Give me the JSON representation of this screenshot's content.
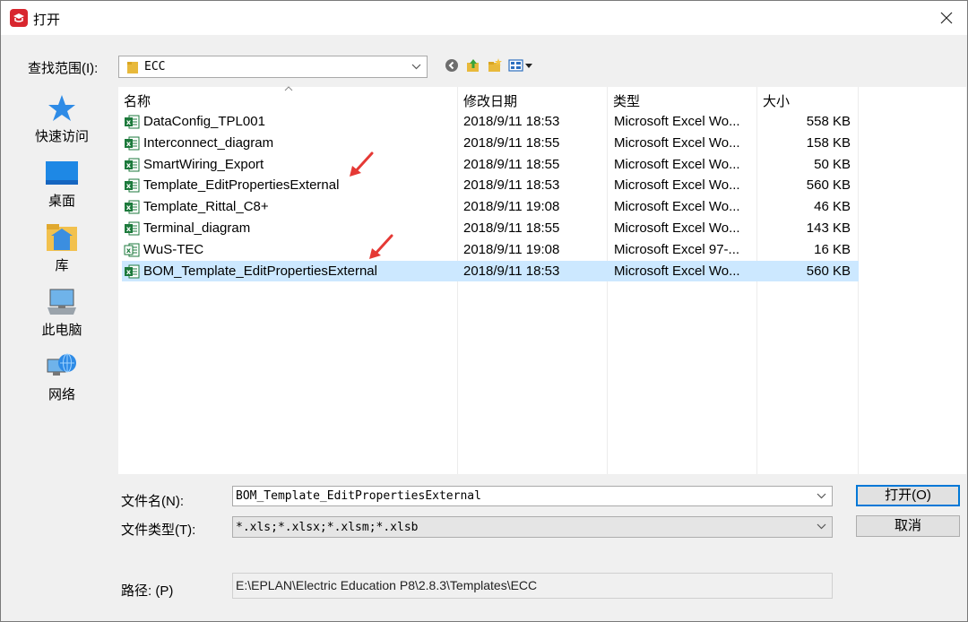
{
  "window": {
    "title": "打开"
  },
  "lookin": {
    "label": "查找范围(I):",
    "value": "ECC"
  },
  "toolbar": {
    "icons": [
      "back-icon",
      "up-folder-icon",
      "new-folder-icon",
      "view-menu-icon"
    ]
  },
  "places": [
    {
      "label": "快速访问",
      "icon": "star-icon"
    },
    {
      "label": "桌面",
      "icon": "desktop-icon"
    },
    {
      "label": "库",
      "icon": "library-icon"
    },
    {
      "label": "此电脑",
      "icon": "computer-icon"
    },
    {
      "label": "网络",
      "icon": "network-icon"
    }
  ],
  "columns": {
    "name": "名称",
    "date": "修改日期",
    "type": "类型",
    "size": "大小"
  },
  "files": [
    {
      "name": "DataConfig_TPL001",
      "date": "2018/9/11 18:53",
      "type": "Microsoft Excel Wo...",
      "size": "558 KB"
    },
    {
      "name": "Interconnect_diagram",
      "date": "2018/9/11 18:55",
      "type": "Microsoft Excel Wo...",
      "size": "158 KB"
    },
    {
      "name": "SmartWiring_Export",
      "date": "2018/9/11 18:55",
      "type": "Microsoft Excel Wo...",
      "size": "50 KB"
    },
    {
      "name": "Template_EditPropertiesExternal",
      "date": "2018/9/11 18:53",
      "type": "Microsoft Excel Wo...",
      "size": "560 KB"
    },
    {
      "name": "Template_Rittal_C8+",
      "date": "2018/9/11 19:08",
      "type": "Microsoft Excel Wo...",
      "size": "46 KB"
    },
    {
      "name": "Terminal_diagram",
      "date": "2018/9/11 18:55",
      "type": "Microsoft Excel Wo...",
      "size": "143 KB"
    },
    {
      "name": "WuS-TEC",
      "date": "2018/9/11 19:08",
      "type": "Microsoft Excel 97-...",
      "size": "16 KB"
    },
    {
      "name": "BOM_Template_EditPropertiesExternal",
      "date": "2018/9/11 18:53",
      "type": "Microsoft Excel Wo...",
      "size": "560 KB"
    }
  ],
  "selected_file_index": 7,
  "filename": {
    "label": "文件名(N):",
    "value": "BOM_Template_EditPropertiesExternal"
  },
  "filetype": {
    "label": "文件类型(T):",
    "value": "*.xls;*.xlsx;*.xlsm;*.xlsb"
  },
  "buttons": {
    "open": "打开(O)",
    "cancel": "取消"
  },
  "path": {
    "label": "路径: (P)",
    "value": "E:\\EPLAN\\Electric Education P8\\2.8.3\\Templates\\ECC"
  },
  "colors": {
    "selection": "#cce8ff",
    "accent": "#0078d7",
    "annotation_arrow": "#e53935",
    "excel_green": "#1d7a3c"
  }
}
